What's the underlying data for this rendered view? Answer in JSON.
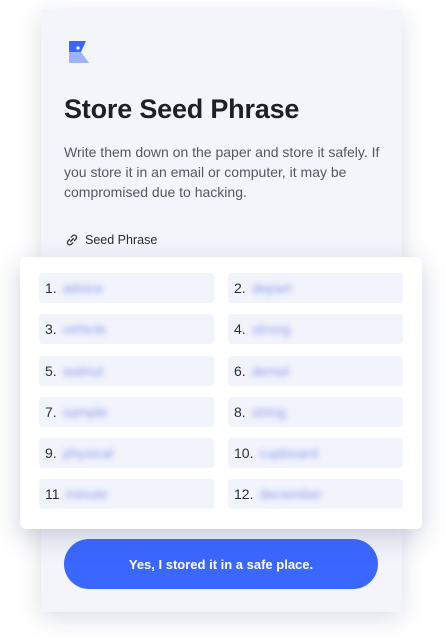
{
  "header": {
    "title": "Store Seed Phrase",
    "description": "Write them down on the paper and store it safely. If you store it in an email or computer, it may be compromised due to hacking."
  },
  "section": {
    "label": "Seed Phrase",
    "icon": "link-icon"
  },
  "seed_words": [
    {
      "num": "1.",
      "word": "advice"
    },
    {
      "num": "2.",
      "word": "depart"
    },
    {
      "num": "3.",
      "word": "vehicle"
    },
    {
      "num": "4.",
      "word": "strong"
    },
    {
      "num": "5.",
      "word": "walnut"
    },
    {
      "num": "6.",
      "word": "denial"
    },
    {
      "num": "7.",
      "word": "sample"
    },
    {
      "num": "8.",
      "word": "string"
    },
    {
      "num": "9.",
      "word": "physical"
    },
    {
      "num": "10.",
      "word": "cupboard"
    },
    {
      "num": "11",
      "word": "minute"
    },
    {
      "num": "12.",
      "word": "december"
    }
  ],
  "cta": {
    "label": "Yes, I stored it in a safe place."
  },
  "colors": {
    "accent": "#3a67ff",
    "card_bg": "#f3f5fb",
    "word_bg": "#f2f4fb"
  }
}
